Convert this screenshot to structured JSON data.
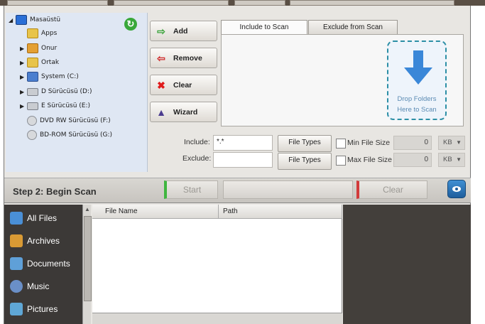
{
  "tree": {
    "items": [
      {
        "label": "Masaüstü",
        "icon": "desktop-icon",
        "expanded": true
      },
      {
        "label": "Apps",
        "icon": "folder-icon"
      },
      {
        "label": "Onur",
        "icon": "user-folder-icon"
      },
      {
        "label": "Ortak",
        "icon": "folder-icon"
      },
      {
        "label": "System (C:)",
        "icon": "system-drive-icon"
      },
      {
        "label": "D Sürücüsü (D:)",
        "icon": "drive-icon"
      },
      {
        "label": "E Sürücüsü (E:)",
        "icon": "drive-icon"
      },
      {
        "label": "DVD RW Sürücüsü (F:)",
        "icon": "dvd-drive-icon"
      },
      {
        "label": "BD-ROM Sürücüsü (G:)",
        "icon": "bdrom-drive-icon"
      }
    ]
  },
  "actions": {
    "add": "Add",
    "remove": "Remove",
    "clear": "Clear",
    "wizard": "Wizard"
  },
  "tabs": {
    "include": "Include to Scan",
    "exclude": "Exclude from Scan"
  },
  "drop": {
    "line1": "Drop Folders",
    "line2": "Here to Scan"
  },
  "filters": {
    "include_label": "Include:",
    "include_value": "*.*",
    "exclude_label": "Exclude:",
    "exclude_value": "",
    "file_types": "File Types",
    "min_label": "Min File Size",
    "max_label": "Max File Size",
    "min_value": "0",
    "max_value": "0",
    "unit": "KB"
  },
  "step2": {
    "title": "Step 2: Begin Scan",
    "start": "Start",
    "clear": "Clear"
  },
  "categories": [
    {
      "label": "All Files",
      "icon": "all-files-icon",
      "color": "#4a8fd6"
    },
    {
      "label": "Archives",
      "icon": "archives-icon",
      "color": "#d99a34"
    },
    {
      "label": "Documents",
      "icon": "documents-icon",
      "color": "#5fa0d8"
    },
    {
      "label": "Music",
      "icon": "music-icon",
      "color": "#6a8fc7"
    },
    {
      "label": "Pictures",
      "icon": "pictures-icon",
      "color": "#5fa7d6"
    }
  ],
  "table": {
    "columns": [
      "File Name",
      "Path"
    ]
  },
  "colors": {
    "accent_blue": "#2c8fa6",
    "start_green": "#3fb63f",
    "clear_red": "#d23b3b"
  }
}
